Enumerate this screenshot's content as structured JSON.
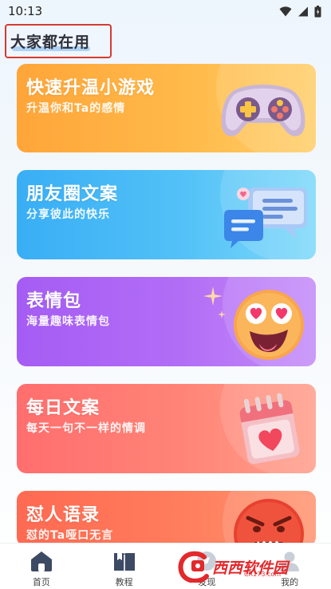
{
  "status_bar": {
    "time": "10:13",
    "icons": [
      "wifi-icon",
      "signal-icon",
      "battery-icon"
    ]
  },
  "section": {
    "title": "大家都在用"
  },
  "cards": [
    {
      "title": "快速升温小游戏",
      "subtitle": "升温你和Ta的感情",
      "art": "gamepad-icon",
      "color": "#ffa53a"
    },
    {
      "title": "朋友圈文案",
      "subtitle": "分享彼此的快乐",
      "art": "chat-bubbles-icon",
      "color": "#39aef5"
    },
    {
      "title": "表情包",
      "subtitle": "海量趣味表情包",
      "art": "emoji-face-icon",
      "color": "#a55cf4"
    },
    {
      "title": "每日文案",
      "subtitle": "每天一句不一样的情调",
      "art": "calendar-heart-icon",
      "color": "#ff6e6e"
    },
    {
      "title": "怼人语录",
      "subtitle": "怼的Ta哑口无言",
      "art": "angry-face-icon",
      "color": "#ff6a52"
    }
  ],
  "nav": {
    "items": [
      {
        "label": "首页",
        "icon": "home-icon",
        "active": true
      },
      {
        "label": "教程",
        "icon": "book-icon",
        "active": false
      },
      {
        "label": "发现",
        "icon": "discover-icon",
        "active": false
      },
      {
        "label": "我的",
        "icon": "profile-icon",
        "active": false
      }
    ]
  },
  "watermark": {
    "logo": "西西软件园",
    "sub": "CR173.com"
  }
}
